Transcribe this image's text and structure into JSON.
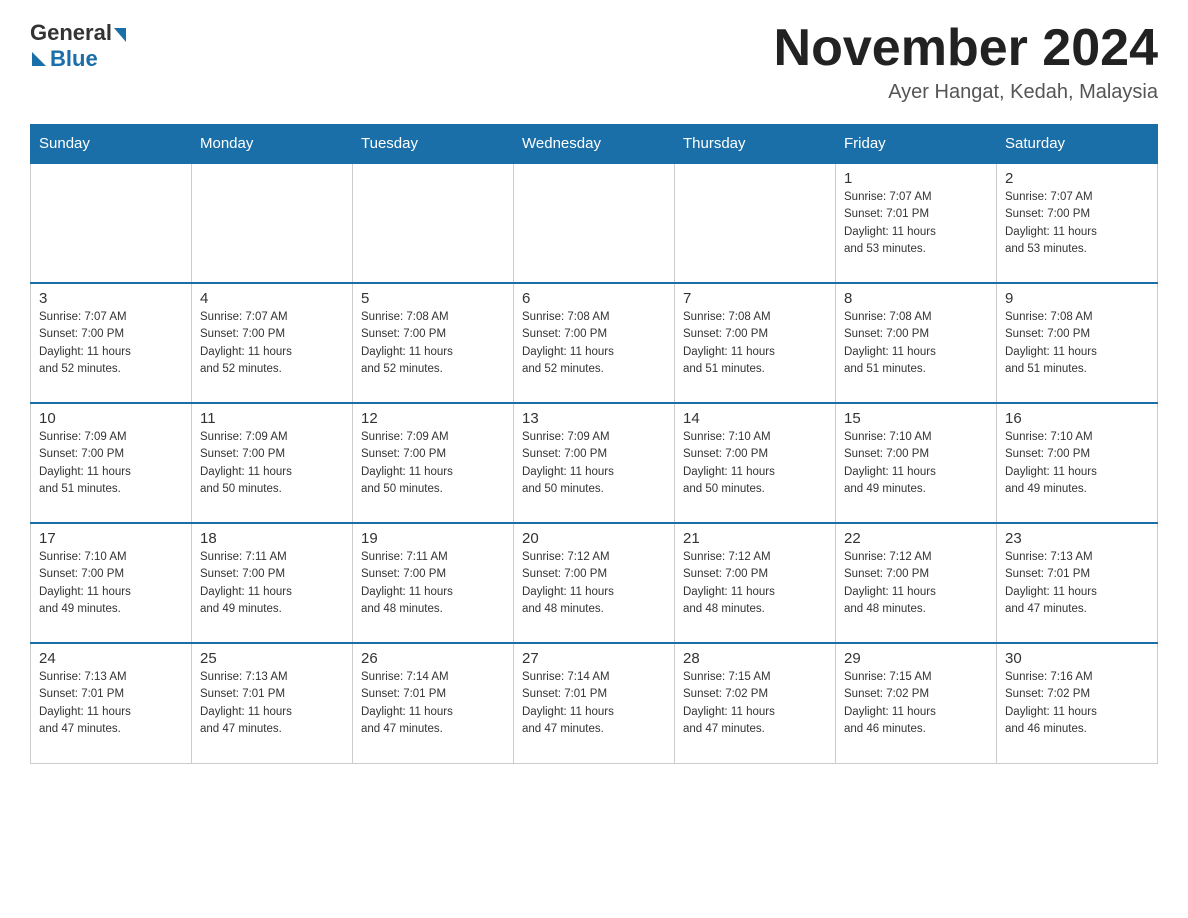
{
  "logo": {
    "general": "General",
    "blue": "Blue"
  },
  "title": "November 2024",
  "location": "Ayer Hangat, Kedah, Malaysia",
  "days_of_week": [
    "Sunday",
    "Monday",
    "Tuesday",
    "Wednesday",
    "Thursday",
    "Friday",
    "Saturday"
  ],
  "weeks": [
    [
      {
        "day": "",
        "info": ""
      },
      {
        "day": "",
        "info": ""
      },
      {
        "day": "",
        "info": ""
      },
      {
        "day": "",
        "info": ""
      },
      {
        "day": "",
        "info": ""
      },
      {
        "day": "1",
        "info": "Sunrise: 7:07 AM\nSunset: 7:01 PM\nDaylight: 11 hours\nand 53 minutes."
      },
      {
        "day": "2",
        "info": "Sunrise: 7:07 AM\nSunset: 7:00 PM\nDaylight: 11 hours\nand 53 minutes."
      }
    ],
    [
      {
        "day": "3",
        "info": "Sunrise: 7:07 AM\nSunset: 7:00 PM\nDaylight: 11 hours\nand 52 minutes."
      },
      {
        "day": "4",
        "info": "Sunrise: 7:07 AM\nSunset: 7:00 PM\nDaylight: 11 hours\nand 52 minutes."
      },
      {
        "day": "5",
        "info": "Sunrise: 7:08 AM\nSunset: 7:00 PM\nDaylight: 11 hours\nand 52 minutes."
      },
      {
        "day": "6",
        "info": "Sunrise: 7:08 AM\nSunset: 7:00 PM\nDaylight: 11 hours\nand 52 minutes."
      },
      {
        "day": "7",
        "info": "Sunrise: 7:08 AM\nSunset: 7:00 PM\nDaylight: 11 hours\nand 51 minutes."
      },
      {
        "day": "8",
        "info": "Sunrise: 7:08 AM\nSunset: 7:00 PM\nDaylight: 11 hours\nand 51 minutes."
      },
      {
        "day": "9",
        "info": "Sunrise: 7:08 AM\nSunset: 7:00 PM\nDaylight: 11 hours\nand 51 minutes."
      }
    ],
    [
      {
        "day": "10",
        "info": "Sunrise: 7:09 AM\nSunset: 7:00 PM\nDaylight: 11 hours\nand 51 minutes."
      },
      {
        "day": "11",
        "info": "Sunrise: 7:09 AM\nSunset: 7:00 PM\nDaylight: 11 hours\nand 50 minutes."
      },
      {
        "day": "12",
        "info": "Sunrise: 7:09 AM\nSunset: 7:00 PM\nDaylight: 11 hours\nand 50 minutes."
      },
      {
        "day": "13",
        "info": "Sunrise: 7:09 AM\nSunset: 7:00 PM\nDaylight: 11 hours\nand 50 minutes."
      },
      {
        "day": "14",
        "info": "Sunrise: 7:10 AM\nSunset: 7:00 PM\nDaylight: 11 hours\nand 50 minutes."
      },
      {
        "day": "15",
        "info": "Sunrise: 7:10 AM\nSunset: 7:00 PM\nDaylight: 11 hours\nand 49 minutes."
      },
      {
        "day": "16",
        "info": "Sunrise: 7:10 AM\nSunset: 7:00 PM\nDaylight: 11 hours\nand 49 minutes."
      }
    ],
    [
      {
        "day": "17",
        "info": "Sunrise: 7:10 AM\nSunset: 7:00 PM\nDaylight: 11 hours\nand 49 minutes."
      },
      {
        "day": "18",
        "info": "Sunrise: 7:11 AM\nSunset: 7:00 PM\nDaylight: 11 hours\nand 49 minutes."
      },
      {
        "day": "19",
        "info": "Sunrise: 7:11 AM\nSunset: 7:00 PM\nDaylight: 11 hours\nand 48 minutes."
      },
      {
        "day": "20",
        "info": "Sunrise: 7:12 AM\nSunset: 7:00 PM\nDaylight: 11 hours\nand 48 minutes."
      },
      {
        "day": "21",
        "info": "Sunrise: 7:12 AM\nSunset: 7:00 PM\nDaylight: 11 hours\nand 48 minutes."
      },
      {
        "day": "22",
        "info": "Sunrise: 7:12 AM\nSunset: 7:00 PM\nDaylight: 11 hours\nand 48 minutes."
      },
      {
        "day": "23",
        "info": "Sunrise: 7:13 AM\nSunset: 7:01 PM\nDaylight: 11 hours\nand 47 minutes."
      }
    ],
    [
      {
        "day": "24",
        "info": "Sunrise: 7:13 AM\nSunset: 7:01 PM\nDaylight: 11 hours\nand 47 minutes."
      },
      {
        "day": "25",
        "info": "Sunrise: 7:13 AM\nSunset: 7:01 PM\nDaylight: 11 hours\nand 47 minutes."
      },
      {
        "day": "26",
        "info": "Sunrise: 7:14 AM\nSunset: 7:01 PM\nDaylight: 11 hours\nand 47 minutes."
      },
      {
        "day": "27",
        "info": "Sunrise: 7:14 AM\nSunset: 7:01 PM\nDaylight: 11 hours\nand 47 minutes."
      },
      {
        "day": "28",
        "info": "Sunrise: 7:15 AM\nSunset: 7:02 PM\nDaylight: 11 hours\nand 47 minutes."
      },
      {
        "day": "29",
        "info": "Sunrise: 7:15 AM\nSunset: 7:02 PM\nDaylight: 11 hours\nand 46 minutes."
      },
      {
        "day": "30",
        "info": "Sunrise: 7:16 AM\nSunset: 7:02 PM\nDaylight: 11 hours\nand 46 minutes."
      }
    ]
  ]
}
